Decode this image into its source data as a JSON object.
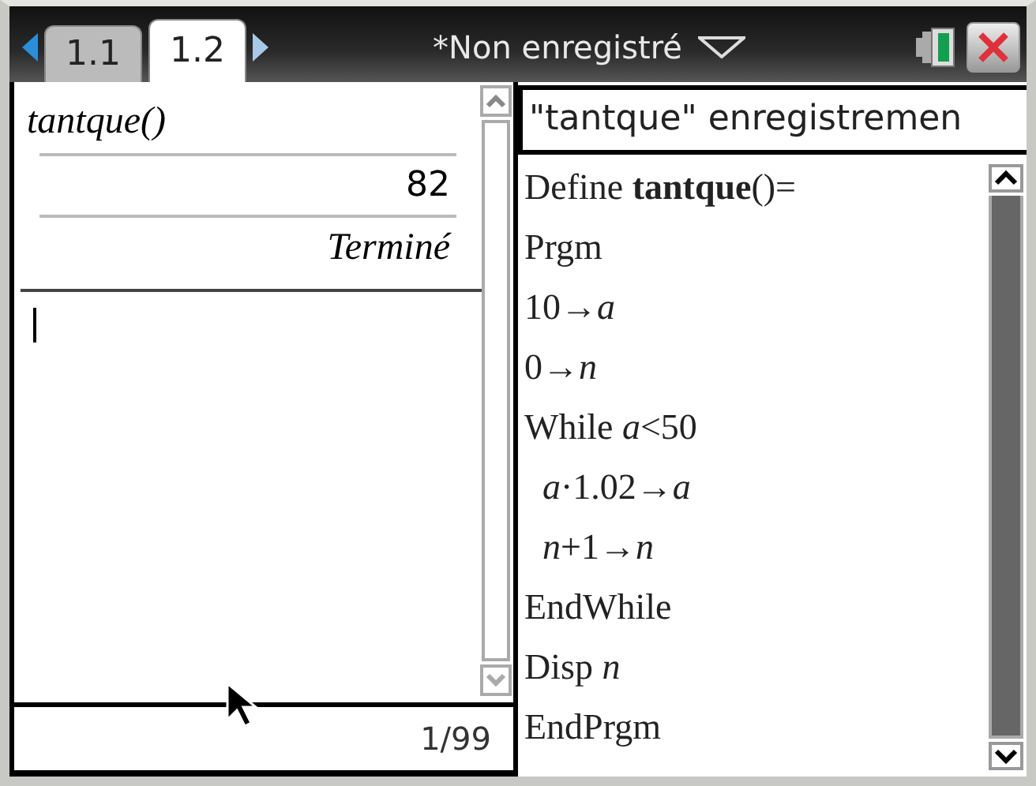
{
  "tabs": [
    {
      "label": "1.1",
      "selected": false
    },
    {
      "label": "1.2",
      "selected": true
    }
  ],
  "document_title": "*Non enregistré",
  "calculator": {
    "history": [
      {
        "kind": "input",
        "text": "tantque()"
      },
      {
        "kind": "output",
        "text": "82"
      },
      {
        "kind": "output_italic",
        "text": "Terminé"
      }
    ],
    "status": "1/99"
  },
  "program_editor": {
    "title": "\"tantque\" enregistremen",
    "lines": [
      {
        "text": "Define **tantque**()="
      },
      {
        "text": "Prgm"
      },
      {
        "text": "10→*a*"
      },
      {
        "text": "0→*n*"
      },
      {
        "text": "While *a*<50"
      },
      {
        "text": "  *a*·1.02→*a*"
      },
      {
        "text": "  *n*+1→*n*"
      },
      {
        "text": "EndWhile"
      },
      {
        "text": "Disp *n*"
      },
      {
        "text": "EndPrgm"
      }
    ]
  }
}
